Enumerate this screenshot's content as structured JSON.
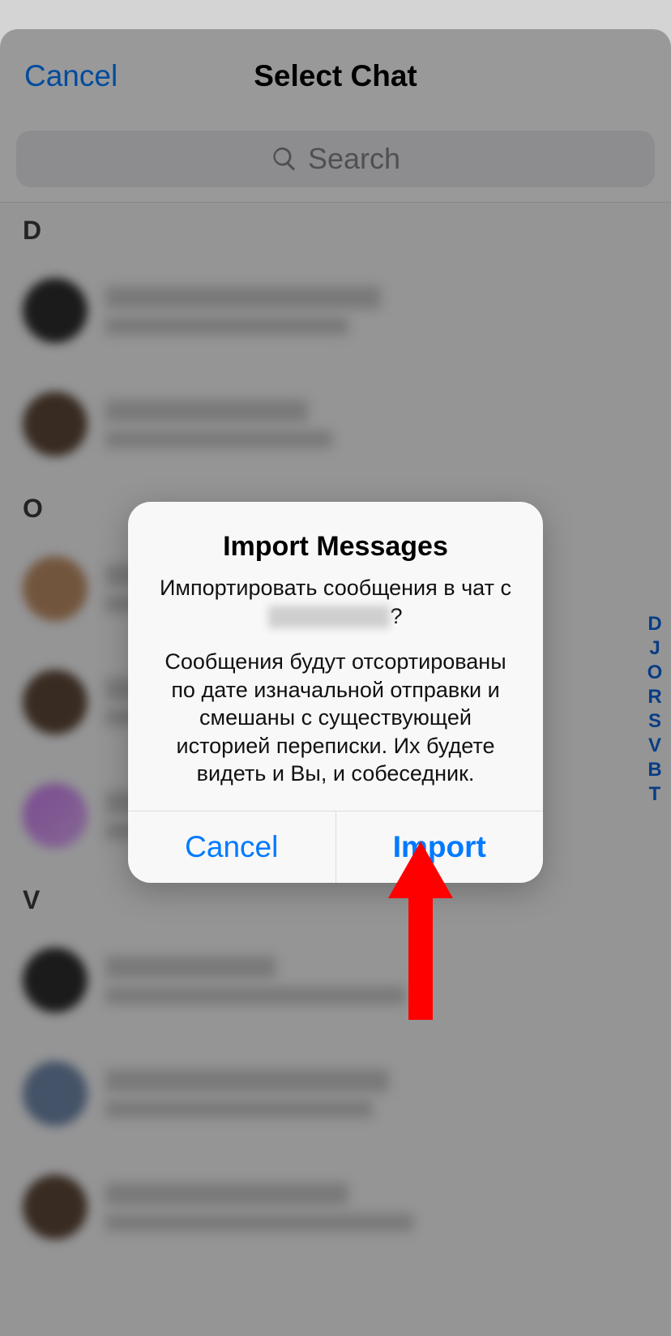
{
  "header": {
    "cancel": "Cancel",
    "title": "Select Chat"
  },
  "search": {
    "placeholder": "Search"
  },
  "sections": {
    "d": "D",
    "o": "O",
    "v": "V"
  },
  "index": [
    "D",
    "J",
    "O",
    "R",
    "S",
    "V",
    "B",
    "T"
  ],
  "alert": {
    "title": "Import Messages",
    "line1": "Импортировать сообщения в чат с",
    "q": "?",
    "body": "Сообщения будут отсортированы по дате изначальной отправки и смешаны с существующей историей переписки. Их будете видеть и Вы, и собеседник.",
    "cancel": "Cancel",
    "import": "Import"
  }
}
